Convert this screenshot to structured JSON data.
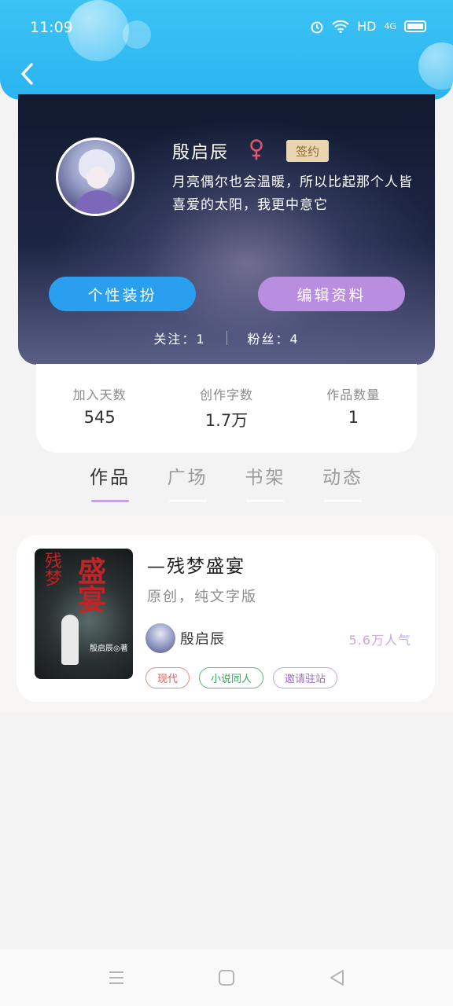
{
  "status_bar": {
    "time": "11:09",
    "hd": "HD",
    "network": "4G"
  },
  "profile": {
    "nickname": "殷启辰",
    "badge": "签约",
    "bio": "月亮偶尔也会温暖，所以比起那个人皆喜爱的太阳，我更中意它",
    "gender_icon": "female-icon",
    "buttons": {
      "style": "个性装扮",
      "edit": "编辑资料"
    },
    "follow_label": "关注：1",
    "fans_label": "粉丝：4"
  },
  "stats": [
    {
      "label": "加入天数",
      "value": "545"
    },
    {
      "label": "创作字数",
      "value": "1.7万"
    },
    {
      "label": "作品数量",
      "value": "1"
    }
  ],
  "tabs": [
    {
      "label": "作品",
      "active": true
    },
    {
      "label": "广场",
      "active": false
    },
    {
      "label": "书架",
      "active": false
    },
    {
      "label": "动态",
      "active": false
    }
  ],
  "work": {
    "title": "—残梦盛宴",
    "type": "原创，纯文字版",
    "cover_text_a": "残梦",
    "cover_text_b": "盛宴",
    "cover_caption": "殷启辰◎著",
    "author": "殷启辰",
    "popularity": "5.6万人气",
    "tags": [
      "现代",
      "小说同人",
      "邀请驻站"
    ]
  },
  "colors": {
    "header": "#2ab4ef",
    "btn_style": "#2a9ff0",
    "btn_edit": "#b98ee0",
    "tab_underline": "#c7a3e6"
  }
}
